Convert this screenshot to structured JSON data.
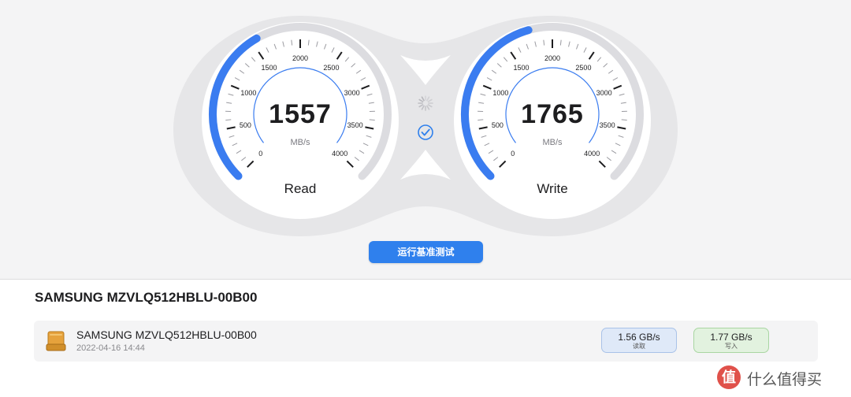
{
  "gauges": [
    {
      "id": "read",
      "title": "Read",
      "value": "1557",
      "unit": "MB/s",
      "speed_mbps": 1557,
      "max_mbps": 4000,
      "ticks": [
        "0",
        "500",
        "1000",
        "1500",
        "2000",
        "2500",
        "3000",
        "3500",
        "4000"
      ]
    },
    {
      "id": "write",
      "title": "Write",
      "value": "1765",
      "unit": "MB/s",
      "speed_mbps": 1765,
      "max_mbps": 4000,
      "ticks": [
        "0",
        "500",
        "1000",
        "1500",
        "2000",
        "2500",
        "3000",
        "3500",
        "4000"
      ]
    }
  ],
  "status_icons": [
    "spinner-icon",
    "checkmark-circle-icon"
  ],
  "run_button_label": "运行基准测试",
  "device": {
    "heading": "SAMSUNG MZVLQ512HBLU-00B00",
    "row": {
      "name": "SAMSUNG MZVLQ512HBLU-00B00",
      "date": "2022-04-16 14:44",
      "icon": "drive-icon",
      "read": {
        "value": "1.56 GB/s",
        "label": "读取"
      },
      "write": {
        "value": "1.77 GB/s",
        "label": "写入"
      }
    }
  },
  "watermark": {
    "logo": "值",
    "text": "什么值得买"
  },
  "colors": {
    "accent_blue": "#2f80ed",
    "arc_blue": "#3a7cf0",
    "panel_bg": "#f4f4f5",
    "read_badge": "#dfe9f8",
    "write_badge": "#e2f2df",
    "drive_orange": "#e6a23c"
  }
}
